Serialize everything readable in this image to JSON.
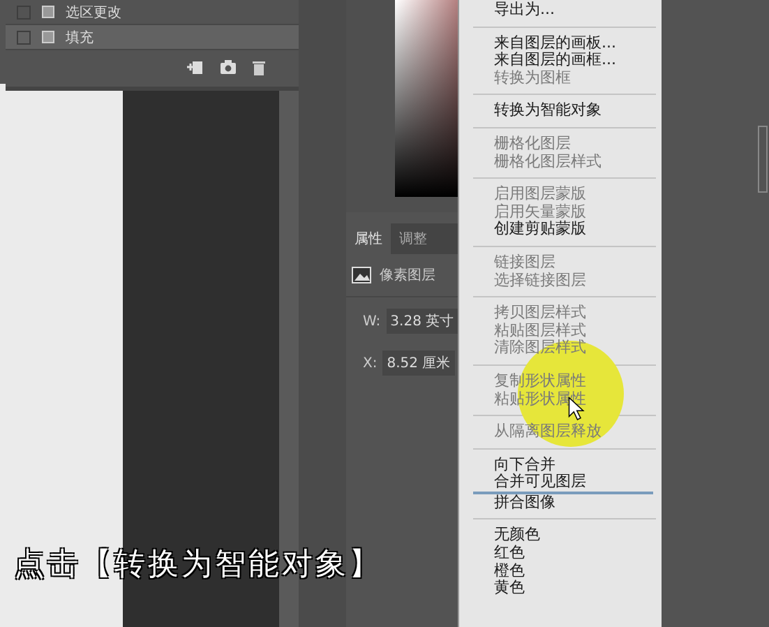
{
  "history_panel": {
    "rows": [
      {
        "label": "选区更改",
        "selected": false
      },
      {
        "label": "填充",
        "selected": true
      }
    ]
  },
  "properties_panel": {
    "tabs": [
      {
        "label": "属性",
        "selected": true
      },
      {
        "label": "调整",
        "selected": false
      }
    ],
    "layer_type": "像素图层",
    "fields": [
      {
        "label": "W:",
        "value": "3.28 英寸"
      },
      {
        "label": "X:",
        "value": "8.52 厘米"
      }
    ]
  },
  "context_menu": {
    "items": [
      {
        "kind": "item",
        "label": "导出为...",
        "disabled": false
      },
      {
        "kind": "separator"
      },
      {
        "kind": "item",
        "label": "来自图层的画板...",
        "disabled": false
      },
      {
        "kind": "item",
        "label": "来自图层的画框...",
        "disabled": false
      },
      {
        "kind": "item",
        "label": "转换为图框",
        "disabled": true
      },
      {
        "kind": "separator"
      },
      {
        "kind": "item",
        "label": "转换为智能对象",
        "disabled": false
      },
      {
        "kind": "separator"
      },
      {
        "kind": "item",
        "label": "栅格化图层",
        "disabled": true
      },
      {
        "kind": "item",
        "label": "栅格化图层样式",
        "disabled": true
      },
      {
        "kind": "separator"
      },
      {
        "kind": "item",
        "label": "启用图层蒙版",
        "disabled": true
      },
      {
        "kind": "item",
        "label": "启用矢量蒙版",
        "disabled": true
      },
      {
        "kind": "item",
        "label": "创建剪贴蒙版",
        "disabled": false
      },
      {
        "kind": "separator"
      },
      {
        "kind": "item",
        "label": "链接图层",
        "disabled": true
      },
      {
        "kind": "item",
        "label": "选择链接图层",
        "disabled": true
      },
      {
        "kind": "separator"
      },
      {
        "kind": "item",
        "label": "拷贝图层样式",
        "disabled": true
      },
      {
        "kind": "item",
        "label": "粘贴图层样式",
        "disabled": true
      },
      {
        "kind": "item",
        "label": "清除图层样式",
        "disabled": true
      },
      {
        "kind": "separator"
      },
      {
        "kind": "item",
        "label": "复制形状属性",
        "disabled": true
      },
      {
        "kind": "item",
        "label": "粘贴形状属性",
        "disabled": true
      },
      {
        "kind": "separator"
      },
      {
        "kind": "item",
        "label": "从隔离图层释放",
        "disabled": true
      },
      {
        "kind": "separator"
      },
      {
        "kind": "item",
        "label": "向下合并",
        "disabled": false
      },
      {
        "kind": "item",
        "label": "合并可见图层",
        "disabled": false
      },
      {
        "kind": "accent-line"
      },
      {
        "kind": "item",
        "label": "拼合图像",
        "disabled": false
      },
      {
        "kind": "separator"
      },
      {
        "kind": "item",
        "label": "无颜色",
        "disabled": false
      },
      {
        "kind": "item",
        "label": "红色",
        "disabled": false
      },
      {
        "kind": "item",
        "label": "橙色",
        "disabled": false
      },
      {
        "kind": "item",
        "label": "黄色",
        "disabled": false
      }
    ]
  },
  "caption": "点击【转换为智能对象】"
}
